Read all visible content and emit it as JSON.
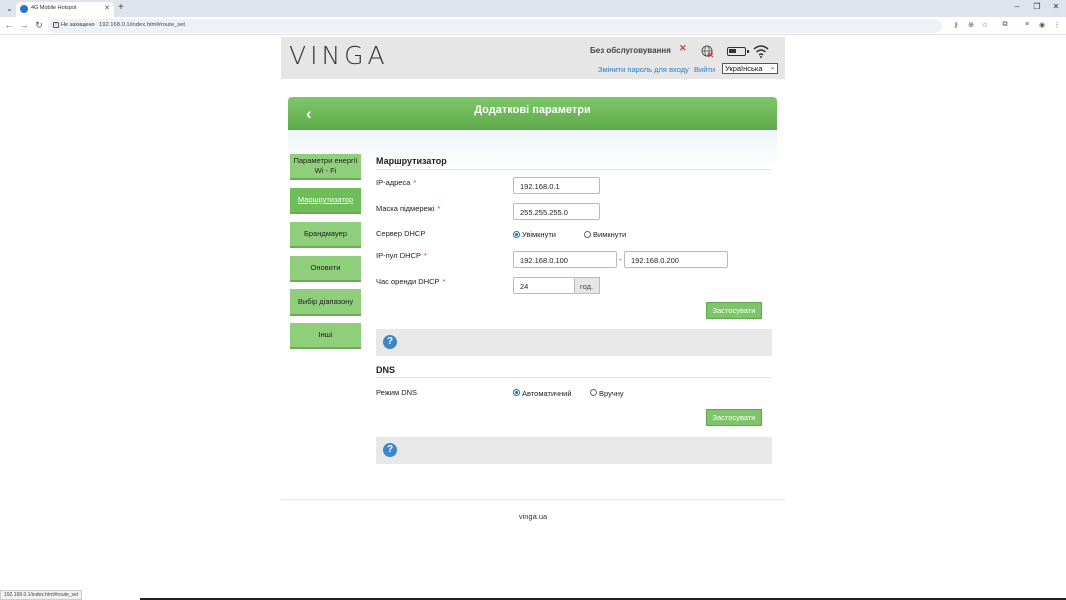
{
  "browser": {
    "tab_title": "4G Mobile Hotspot",
    "security_label": "Не захищено",
    "url": "192.168.0.1/index.html#route_set",
    "status_url": "192.168.0.1/index.html#route_set"
  },
  "header": {
    "logo": "VINGA",
    "service_status": "Без обслуговування",
    "change_password": "Змінити пароль для входу",
    "logout": "Вийти",
    "language": "Українська"
  },
  "page_title": "Додаткові параметри",
  "sidebar": {
    "items": [
      {
        "label": "Параметри енергії Wi - Fi"
      },
      {
        "label": "Маршрутизатор"
      },
      {
        "label": "Брандмауер"
      },
      {
        "label": "Оновити"
      },
      {
        "label": "Вибір діапазону"
      },
      {
        "label": "Інші"
      }
    ]
  },
  "router": {
    "title": "Маршрутизатор",
    "ip_label": "IP-адреса",
    "ip_value": "192.168.0.1",
    "mask_label": "Маска підмережі",
    "mask_value": "255.255.255.0",
    "dhcp_label": "Сервер DHCP",
    "dhcp_on": "Увімкнути",
    "dhcp_off": "Вимкнути",
    "pool_label": "IP-пул DHCP",
    "pool_start": "192.168.0.100",
    "pool_dash": "-",
    "pool_end": "192.168.0.200",
    "lease_label": "Час оренди DHCP",
    "lease_value": "24",
    "lease_unit": "год.",
    "apply": "Застосувати",
    "required_mark": "*"
  },
  "dns": {
    "title": "DNS",
    "mode_label": "Режим DNS",
    "auto": "Автоматичний",
    "manual": "Вручну",
    "apply": "Застосувати"
  },
  "help_icon": "?",
  "footer": "vinga.ua"
}
